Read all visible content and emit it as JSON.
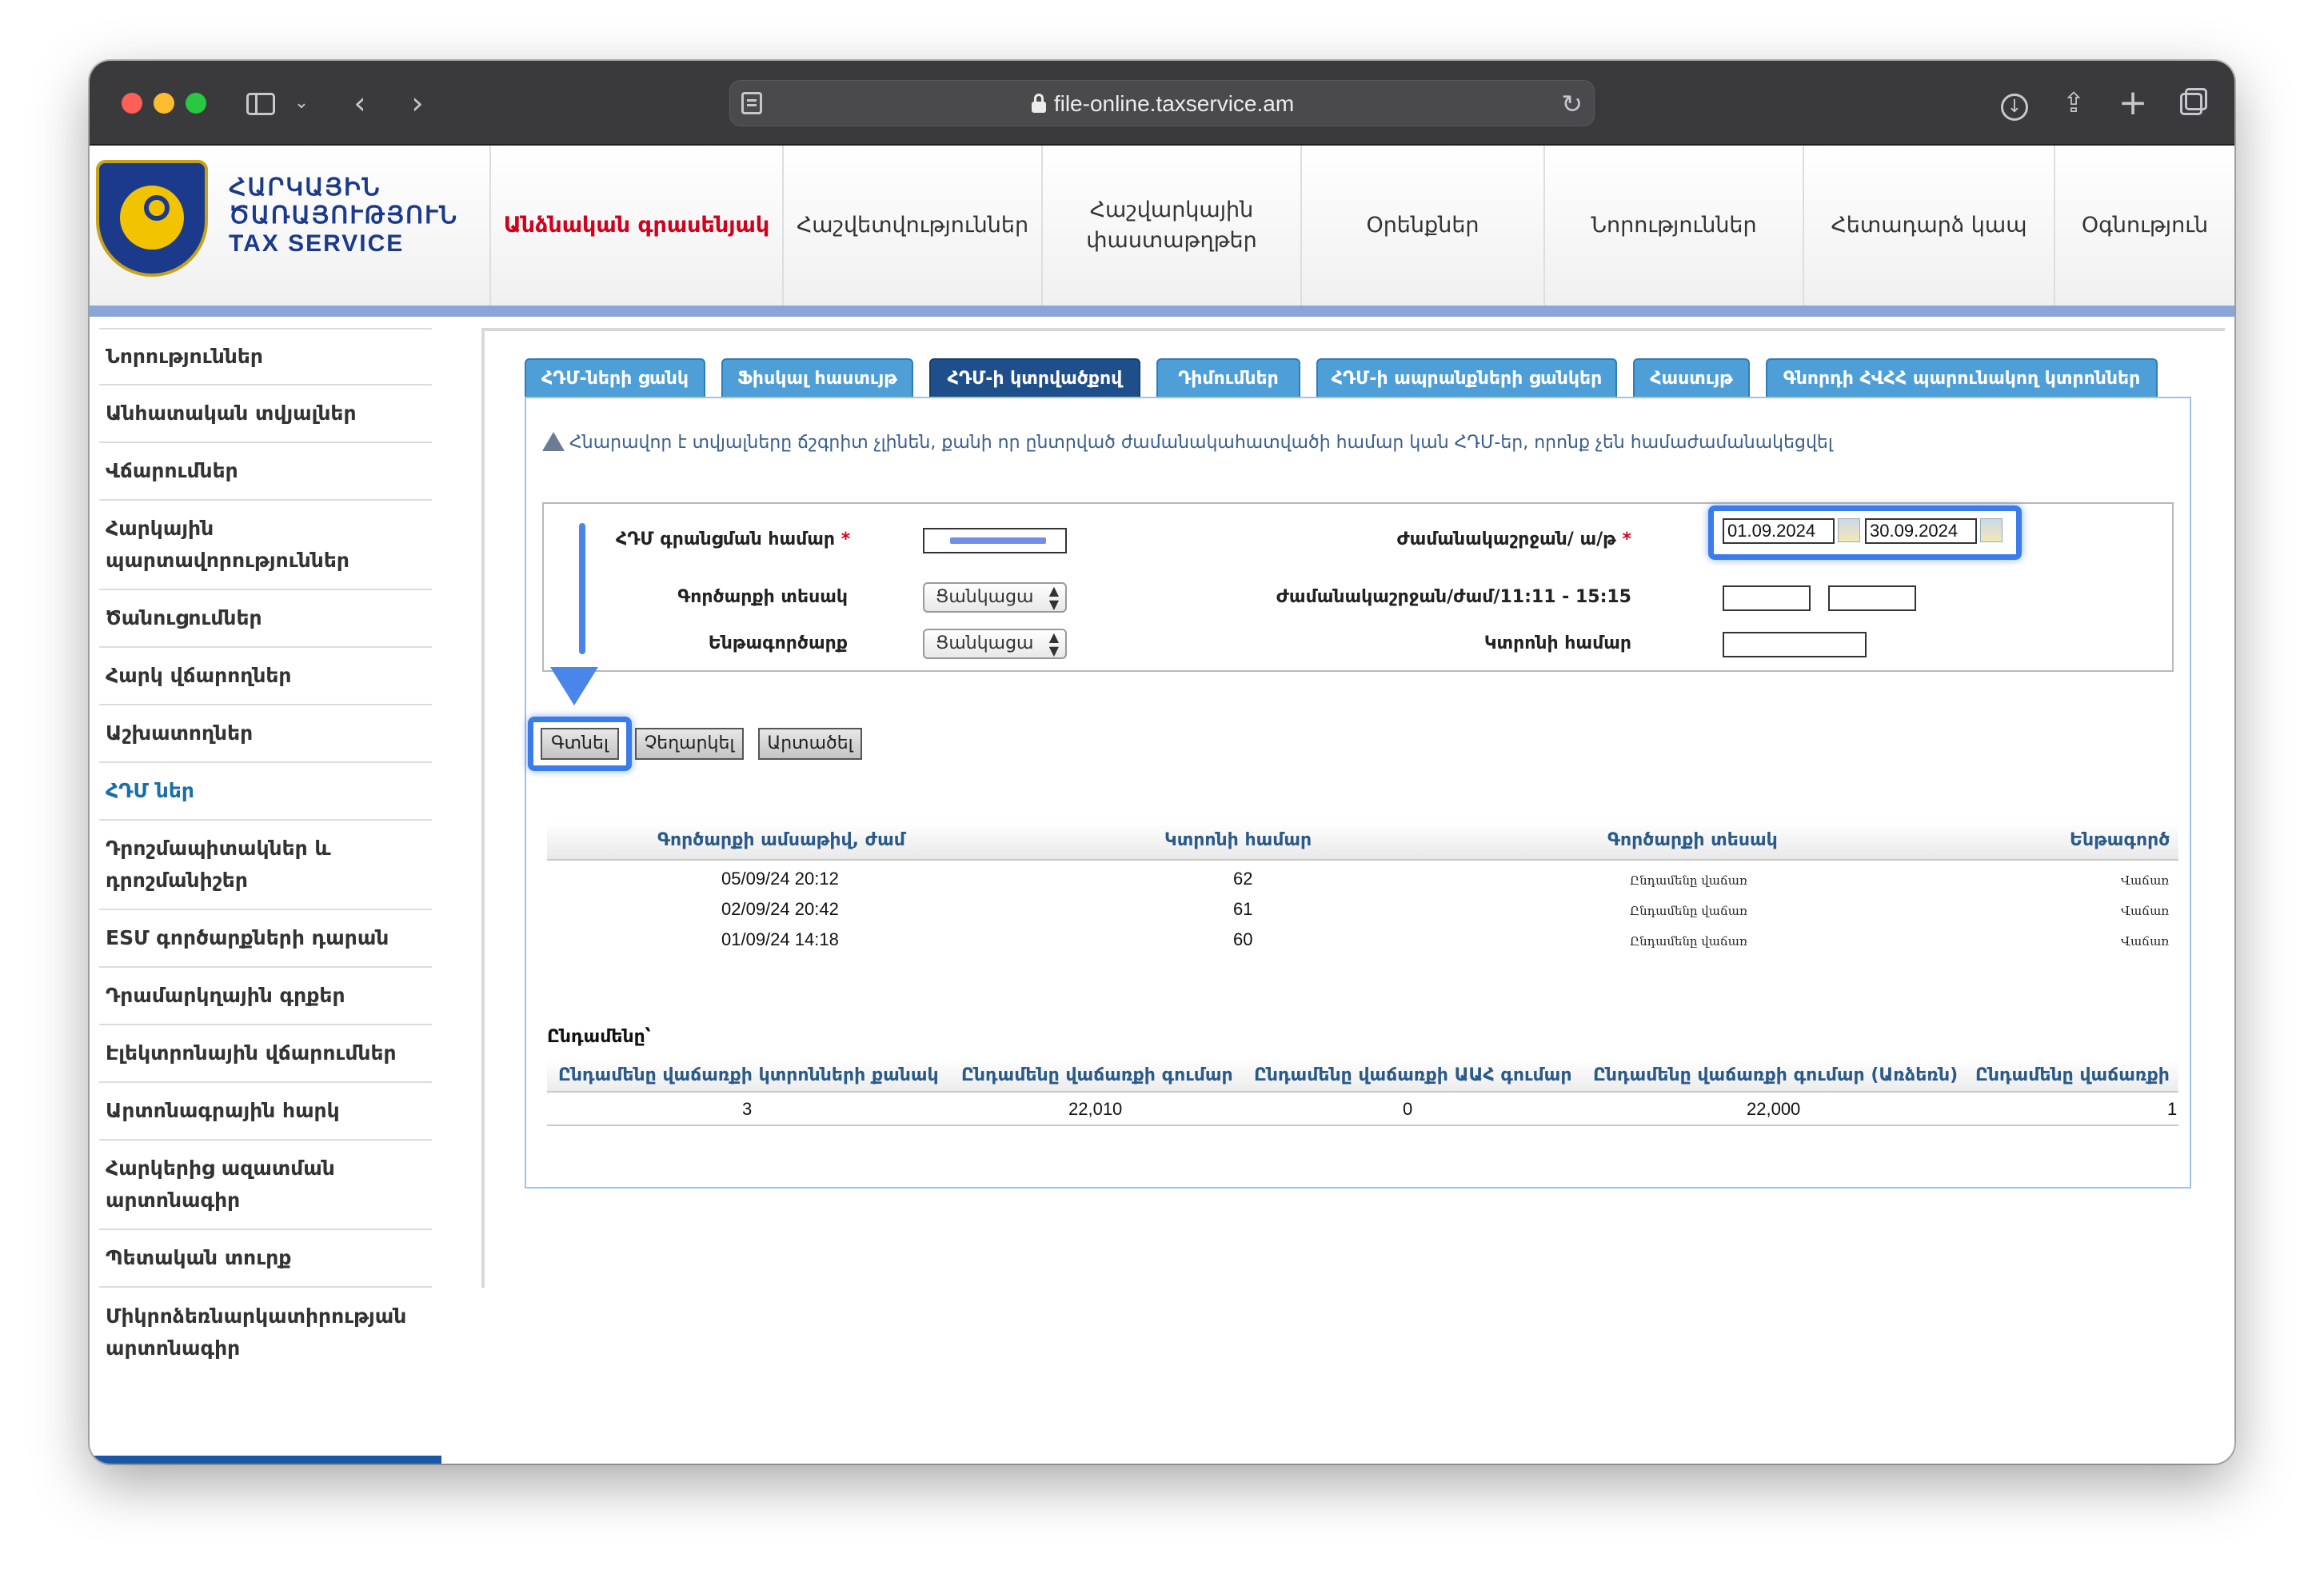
{
  "browser": {
    "url": "file-online.taxservice.am"
  },
  "logo": {
    "line1": "ՀԱՐԿԱՅԻՆ",
    "line2": "ԾԱՌԱՅՈՒԹՅՈՒՆ",
    "line3": "TAX SERVICE"
  },
  "nav": {
    "items": [
      {
        "label": "Անձնական գրասենյակ",
        "active": true
      },
      {
        "label": "Հաշվետվություններ",
        "active": false
      },
      {
        "label_line1": "Հաշվարկային",
        "label_line2": "փաստաթղթեր",
        "active": false
      },
      {
        "label": "Օրենքներ",
        "active": false
      },
      {
        "label": "Նորություններ",
        "active": false
      },
      {
        "label": "Հետադարձ կապ",
        "active": false
      },
      {
        "label": "Օգնություն",
        "active": false
      }
    ]
  },
  "sidebar": {
    "items": [
      {
        "label": "Նորություններ"
      },
      {
        "label": "Անհատական տվյալներ"
      },
      {
        "label": "Վճարումներ"
      },
      {
        "label_line1": "Հարկային",
        "label_line2": "պարտավորություններ"
      },
      {
        "label": "Ծանուցումներ"
      },
      {
        "label": "Հարկ վճարողներ"
      },
      {
        "label": "Աշխատողներ"
      },
      {
        "label": "ՀԴՄ ներ",
        "active": true
      },
      {
        "label_line1": "Դրոշմապիտակներ և",
        "label_line2": "դրոշմանիշեր"
      },
      {
        "label": "ESՄ գործարքների դարան"
      },
      {
        "label": "Դրամարկղային գրքեր"
      },
      {
        "label": "Էլեկտրոնային վճարումներ"
      },
      {
        "label": "Արտոնագրային հարկ"
      },
      {
        "label_line1": "Հարկերից ազատման",
        "label_line2": "արտոնագիր"
      },
      {
        "label": "Պետական տուրք"
      },
      {
        "label_line1": "Միկրոձեռնարկատիրության",
        "label_line2": "արտոնագիր"
      }
    ]
  },
  "tabs": [
    {
      "label": "ՀԴՄ-ների ցանկ"
    },
    {
      "label": "Ֆիսկալ հաստւյթ"
    },
    {
      "label": "ՀԴՄ-ի կտրվածքով",
      "active": true
    },
    {
      "label": "Դիմումներ"
    },
    {
      "label": "ՀԴՄ-ի ապրանքների ցանկեր"
    },
    {
      "label": "Հաստւյթ"
    },
    {
      "label": "Գնորդի ՀՎՀՀ պարունակող կտրոններ"
    }
  ],
  "warning": {
    "text": "Հնարավոր է տվյալները ճշգրիտ չլինեն, քանի որ ընտրված ժամանակահատվածի համար կան ՀԴՄ-եր, որոնք չեն համաժամանակեցվել"
  },
  "form": {
    "reg_number_label": "ՀԴՄ գրանցման համար",
    "period_label": "Ժամանակաշրջան/ ա/թ",
    "date_from": "01.09.2024",
    "date_to": "30.09.2024",
    "operation_type_label": "Գործարքի տեսակ",
    "operation_type_value": "Ցանկացա",
    "time_period_label": "Ժամանակաշրջան/ժամ/11:11 - 15:15",
    "suboperation_label": "Ենթագործարք",
    "suboperation_value": "Ցանկացա",
    "receipt_number_label": "Կտրոնի համար",
    "required_mark": "*"
  },
  "buttons": {
    "search": "Գտնել",
    "cancel": "Չեղարկել",
    "export": "Արտածել"
  },
  "results": {
    "columns": [
      "Գործարքի ամսաթիվ, ժամ",
      "Կտրոնի համար",
      "Գործարքի տեսակ",
      "Ենթագործ"
    ],
    "rows": [
      {
        "datetime": "05/09/24 20:12",
        "receipt": "62",
        "type": "Ընդամենը վաճառ",
        "sub": "Վաճառ"
      },
      {
        "datetime": "02/09/24 20:42",
        "receipt": "61",
        "type": "Ընդամենը վաճառ",
        "sub": "Վաճառ"
      },
      {
        "datetime": "01/09/24 14:18",
        "receipt": "60",
        "type": "Ընդամենը վաճառ",
        "sub": "Վաճառ"
      }
    ]
  },
  "totals": {
    "title": "Ընդամենը՝",
    "columns": [
      "Ընդամենը վաճառքի կտրոնների քանակ",
      "Ընդամենը վաճառքի գումար",
      "Ընդամենը վաճառքի ԱԱՀ գումար",
      "Ընդամենը վաճառքի գումար (Առձեռն)",
      "Ընդամենը վաճառքի"
    ],
    "values": [
      "3",
      "22,010",
      "0",
      "22,000",
      "1"
    ]
  },
  "colors": {
    "active_nav": "#d0021b",
    "tab_blue": "#4e9fd8",
    "tab_active": "#1f4f8a",
    "highlight": "#3b7bea"
  }
}
